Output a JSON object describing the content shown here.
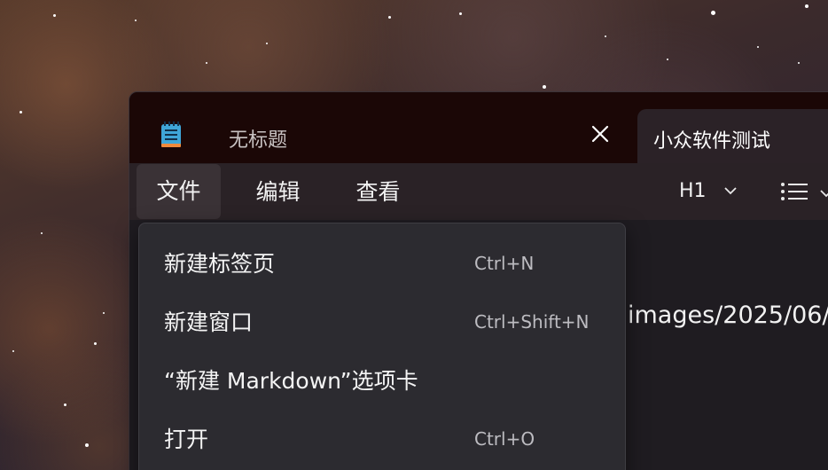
{
  "window": {
    "tabs": [
      {
        "label": "无标题",
        "active": false
      },
      {
        "label": "小众软件测试",
        "active": true
      }
    ],
    "app_icon": "notepad-icon",
    "close_icon": "close-icon"
  },
  "menubar": {
    "items": [
      {
        "label": "文件"
      },
      {
        "label": "编辑"
      },
      {
        "label": "查看"
      }
    ],
    "heading_select": {
      "value": "H1",
      "icon": "chevron-down-icon"
    },
    "list_button": {
      "icon": "bulleted-list-icon",
      "dropdown_icon": "chevron-down-icon"
    }
  },
  "editor": {
    "visible_text": "images/2025/06/"
  },
  "file_menu": {
    "items": [
      {
        "label": "新建标签页",
        "shortcut": "Ctrl+N"
      },
      {
        "label": "新建窗口",
        "shortcut": "Ctrl+Shift+N"
      },
      {
        "label": "“新建 Markdown”选项卡",
        "shortcut": ""
      },
      {
        "label": "打开",
        "shortcut": "Ctrl+O"
      }
    ]
  },
  "colors": {
    "titlebar": "#1b0706",
    "menubar": "#2a2226",
    "dropdown": "#2c2b30",
    "text": "#f2f2f2"
  }
}
